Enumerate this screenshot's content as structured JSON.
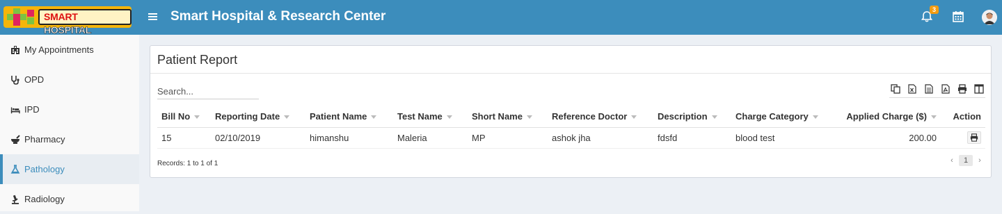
{
  "header": {
    "logo_text_red": "SMART ",
    "logo_text_white": "HOSPITAL",
    "app_title": "Smart Hospital & Research Center",
    "notification_count": "3"
  },
  "sidebar": {
    "items": [
      {
        "label": "My Appointments",
        "icon": "hospital-icon",
        "active": false
      },
      {
        "label": "OPD",
        "icon": "stethoscope-icon",
        "active": false
      },
      {
        "label": "IPD",
        "icon": "bed-icon",
        "active": false
      },
      {
        "label": "Pharmacy",
        "icon": "mortar-pestle-icon",
        "active": false
      },
      {
        "label": "Pathology",
        "icon": "flask-icon",
        "active": true
      },
      {
        "label": "Radiology",
        "icon": "microscope-icon",
        "active": false
      }
    ]
  },
  "report": {
    "title": "Patient Report",
    "search_placeholder": "Search...",
    "columns": [
      "Bill No",
      "Reporting Date",
      "Patient Name",
      "Test Name",
      "Short Name",
      "Reference Doctor",
      "Description",
      "Charge Category",
      "Applied Charge ($)",
      "Action"
    ],
    "rows": [
      {
        "bill_no": "15",
        "reporting_date": "02/10/2019",
        "patient_name": "himanshu",
        "test_name": "Maleria",
        "short_name": "MP",
        "reference_doctor": "ashok jha",
        "description": "fdsfd",
        "charge_category": "blood test",
        "applied_charge": "200.00"
      }
    ],
    "records_text": "Records: 1 to 1 of 1",
    "current_page": "1",
    "prev_label": "‹",
    "next_label": "›"
  },
  "colors": {
    "topbar": "#3c8dbc",
    "accent": "#3c8dbc",
    "badge": "#f39c12",
    "logo": "#f5b50a"
  }
}
